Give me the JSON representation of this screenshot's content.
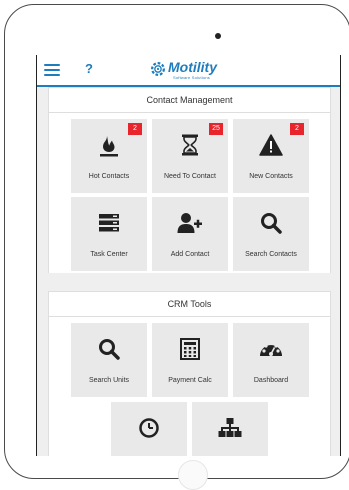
{
  "topbar": {
    "help_label": "?",
    "logo_brand": "Motility",
    "logo_tagline": "Software Solutions",
    "accent_color": "#1e7dbe"
  },
  "contact_management": {
    "title": "Contact Management",
    "tiles": [
      {
        "label": "Hot Contacts",
        "icon": "flame-icon",
        "badge": "2"
      },
      {
        "label": "Need To Contact",
        "icon": "hourglass-icon",
        "badge": "25"
      },
      {
        "label": "New Contacts",
        "icon": "warning-icon",
        "badge": "2"
      },
      {
        "label": "Task Center",
        "icon": "task-list-icon"
      },
      {
        "label": "Add Contact",
        "icon": "add-user-icon"
      },
      {
        "label": "Search Contacts",
        "icon": "search-icon"
      }
    ]
  },
  "crm_tools": {
    "title": "CRM Tools",
    "tiles": [
      {
        "label": "Search Units",
        "icon": "search-icon"
      },
      {
        "label": "Payment Calc",
        "icon": "calculator-icon"
      },
      {
        "label": "Dashboard",
        "icon": "dashboard-icon"
      },
      {
        "label": "",
        "icon": "clock-icon"
      },
      {
        "label": "",
        "icon": "org-chart-icon"
      }
    ]
  },
  "colors": {
    "badge": "#e8242d",
    "icon": "#222222",
    "tile_bg": "#e9e9e9",
    "panel_bg": "#efefef"
  }
}
